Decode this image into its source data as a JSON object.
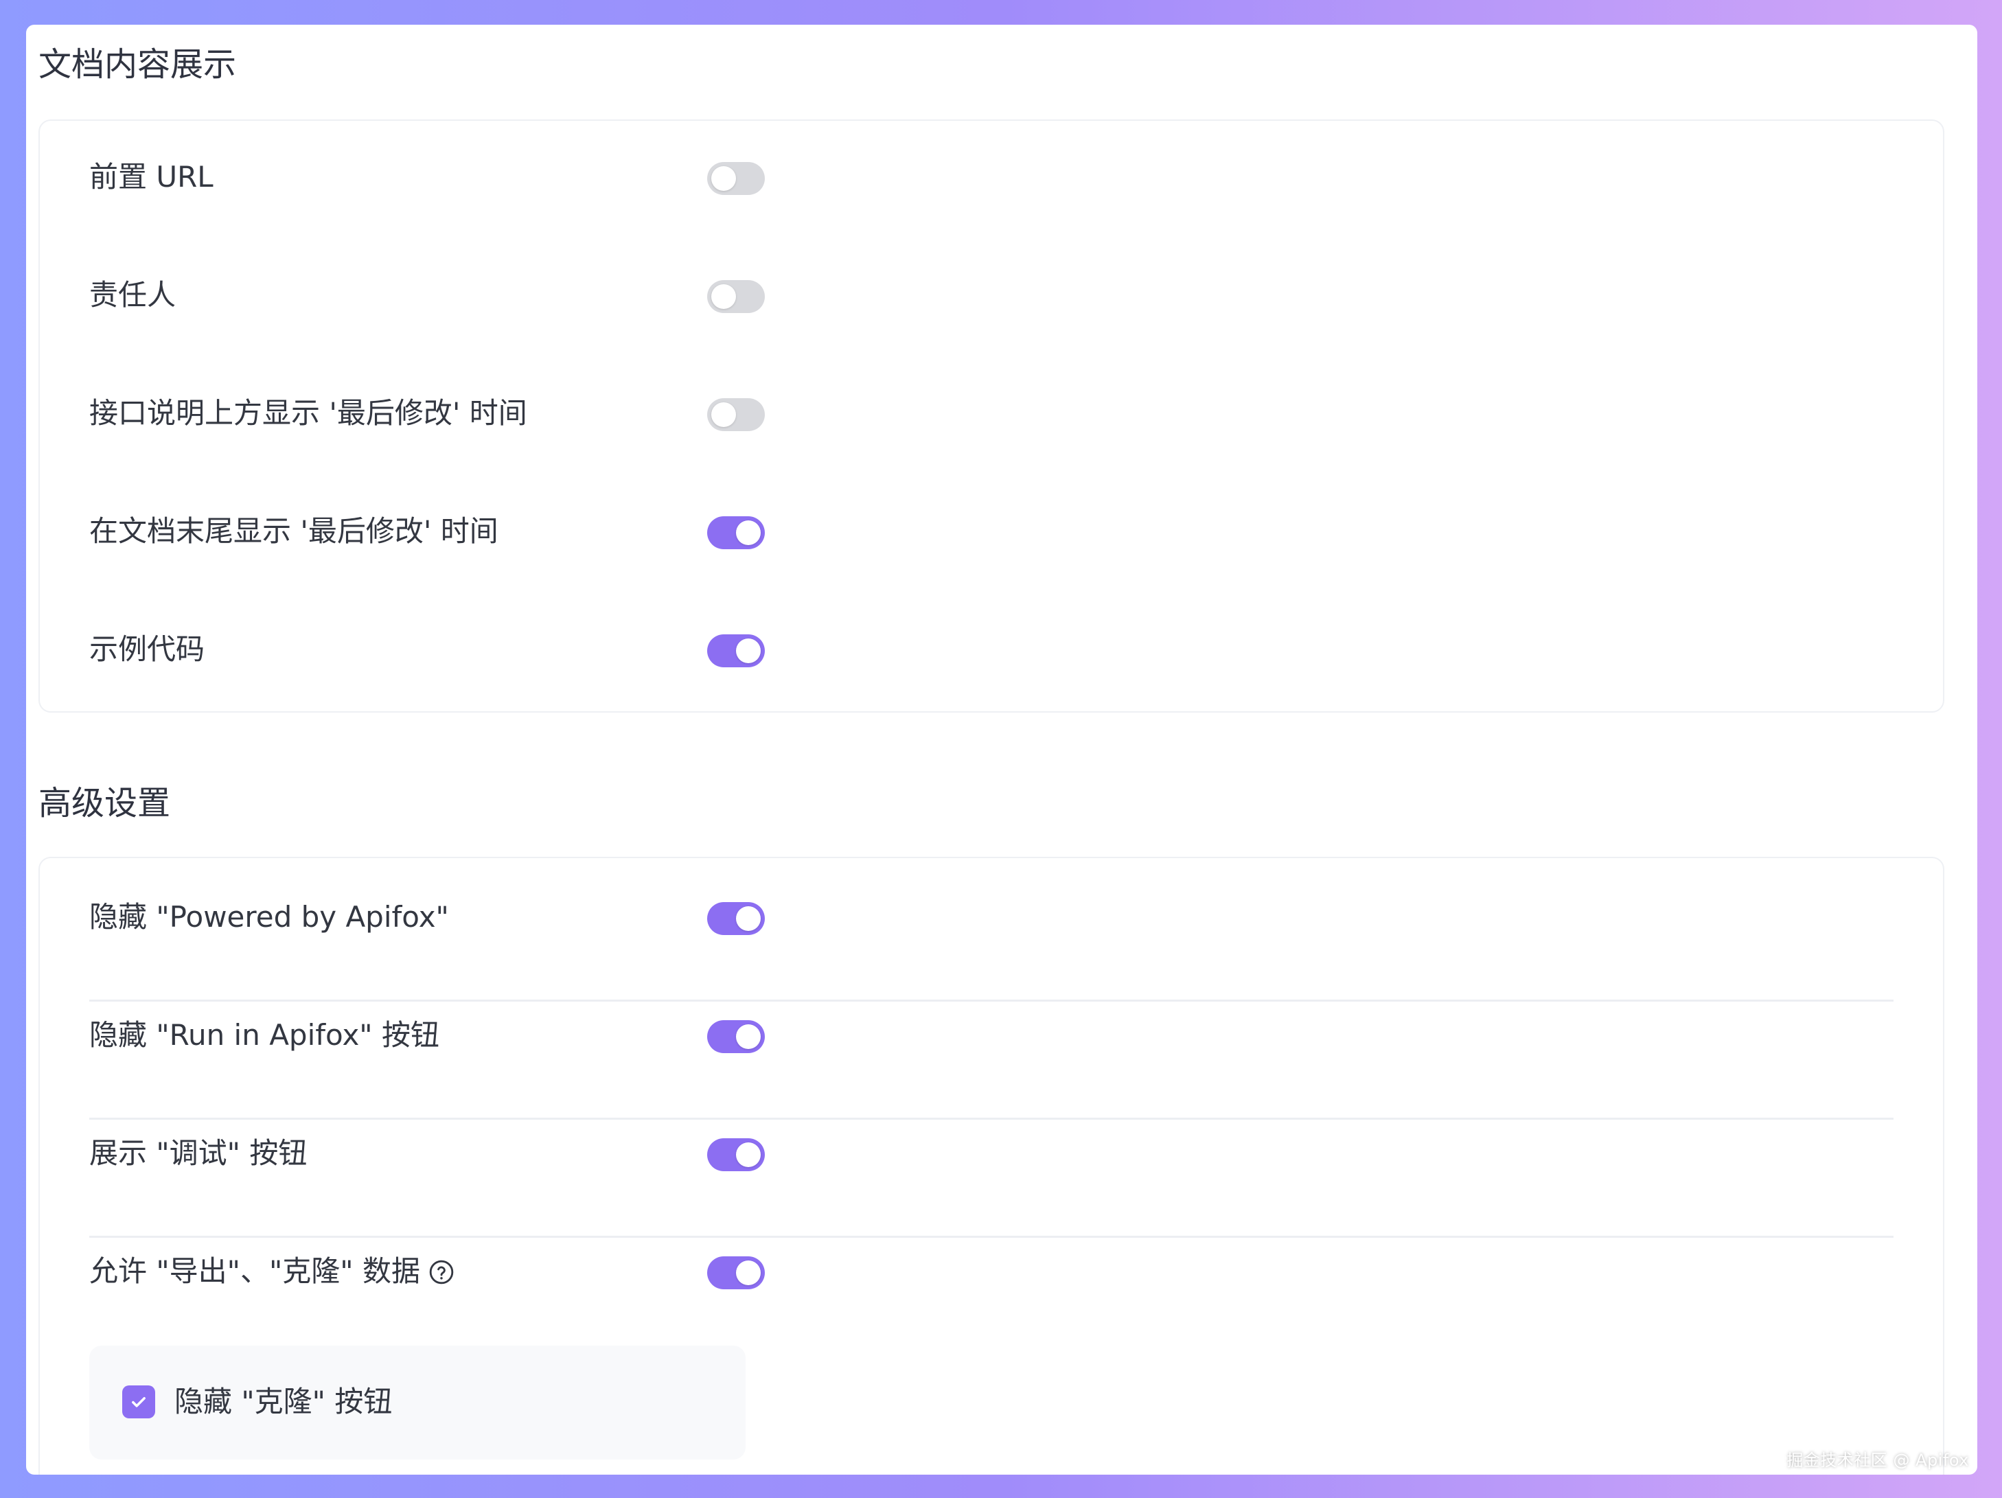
{
  "sections": {
    "doc_display": {
      "title": "文档内容展示",
      "rows": [
        {
          "label": "前置 URL",
          "enabled": false
        },
        {
          "label": "责任人",
          "enabled": false
        },
        {
          "label": "接口说明上方显示 '最后修改' 时间",
          "enabled": false
        },
        {
          "label": "在文档末尾显示 '最后修改' 时间",
          "enabled": true
        },
        {
          "label": "示例代码",
          "enabled": true
        }
      ]
    },
    "advanced": {
      "title": "高级设置",
      "rows": [
        {
          "label": "隐藏 \"Powered by Apifox\"",
          "enabled": true
        },
        {
          "label": "隐藏 \"Run in Apifox\" 按钮",
          "enabled": true
        },
        {
          "label": "展示 \"调试\" 按钮",
          "enabled": true
        },
        {
          "label": "允许 \"导出\"、\"克隆\" 数据",
          "enabled": true,
          "icon": "help-circle-icon"
        }
      ],
      "sub_option": {
        "label": "隐藏 \"克隆\" 按钮",
        "checked": true
      }
    }
  },
  "watermark": "掘金技术社区 @ Apifox",
  "colors": {
    "accent": "#8c6ef2",
    "toggle_off": "#d8d9dd",
    "frame_left": "#8f9bff",
    "frame_right": "#d2a6f8"
  }
}
